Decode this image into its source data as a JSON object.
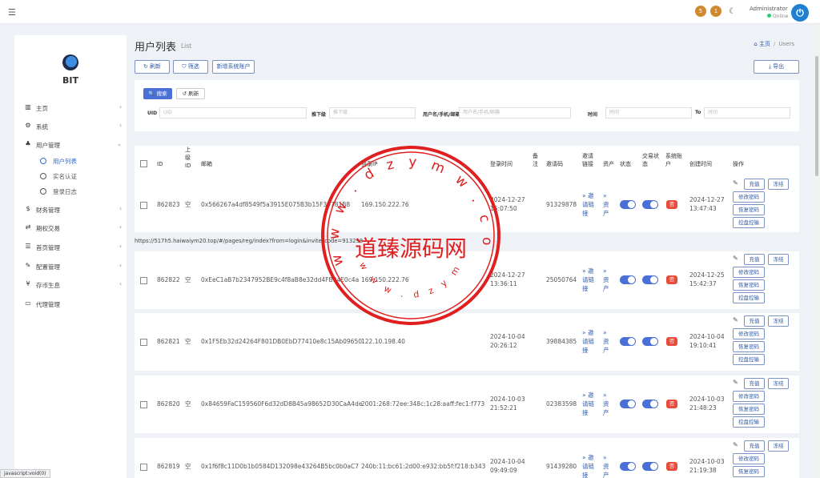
{
  "topbar": {
    "badge1": "5",
    "badge2": "1",
    "admin": "Administrator",
    "online": "Online"
  },
  "sidebar": {
    "brand": "BIT",
    "items": [
      {
        "icon": "bar-chart-icon",
        "glyph": "▥",
        "label": "主页"
      },
      {
        "icon": "gear-icon",
        "glyph": "⚙",
        "label": "系统"
      },
      {
        "icon": "users-icon",
        "glyph": "👤",
        "label": "用户管理"
      },
      {
        "icon": "dollar-icon",
        "glyph": "$",
        "label": "财务管理"
      },
      {
        "icon": "exchange-icon",
        "glyph": "⇄",
        "label": "期权交易"
      },
      {
        "icon": "list-icon",
        "glyph": "☰",
        "label": "首页管理"
      },
      {
        "icon": "wrench-icon",
        "glyph": "🔧",
        "label": "配置管理"
      },
      {
        "icon": "yen-icon",
        "glyph": "¥",
        "label": "存币生息"
      },
      {
        "icon": "id-card-icon",
        "glyph": "▭",
        "label": "代理管理"
      }
    ],
    "sub": [
      "用户列表",
      "实名认证",
      "登录日志"
    ]
  },
  "header": {
    "title": "用户列表",
    "subtitle": "List",
    "crumb_home": "主页",
    "crumb_current": "Users"
  },
  "toolbar": {
    "refresh": "↻ 刷新",
    "filter": "⛉ 筛选",
    "add": "新增系统账户",
    "export": "⤓ 导出"
  },
  "search": {
    "search_btn": "🔍 搜索",
    "reset_btn": "↺ 刷新",
    "uid_label": "UID",
    "uid_placeholder": "UID",
    "parent_label": "推下级",
    "parent_placeholder": "推下级",
    "user_label": "用户名/手机/邮箱",
    "user_placeholder": "用户名/手机/邮箱",
    "time_label": "时间",
    "time_placeholder": "时间",
    "to_label": "To",
    "to_placeholder": "时间"
  },
  "table": {
    "headers": {
      "id": "ID",
      "parent_id": "上级ID",
      "email": "邮箱",
      "ip": "登录IP",
      "login_time": "登录时间",
      "remark": "备注",
      "invite_code": "邀请码",
      "invite_link": "邀请链接",
      "assets": "资产",
      "status": "状态",
      "trade_status": "交易状态",
      "sys_account": "系统账户",
      "created": "创建时间",
      "actions": "操作"
    },
    "rows": [
      {
        "id": "862823",
        "parent": "空",
        "email": "0x566267a4df8549f5a3915E075B3b15F39781B8",
        "ip": "169.150.222.76",
        "login_time": "2024-12-27 15:07:50",
        "code": "91329878",
        "created": "2024-12-27 13:47:43"
      },
      {
        "id": "862822",
        "parent": "空",
        "email": "0xEeC1aB7b2347952BE9c4f8aB8e32dd4FB94E0c4a",
        "ip": "169.150.222.76",
        "login_time": "2024-12-27 13:36:11",
        "code": "25050764",
        "created": "2024-12-25 15:42:37"
      },
      {
        "id": "862821",
        "parent": "空",
        "email": "0x1F5Eb32d24264F801DB0EbD77410e8c15Ab09650",
        "ip": "122.10.198.40",
        "login_time": "2024-10-04 20:26:12",
        "code": "39884385",
        "created": "2024-10-04 19:10:41"
      },
      {
        "id": "862820",
        "parent": "空",
        "email": "0x84659FaC159560F6d32dD8B45a98652D30CaA4de",
        "ip": "2001:268:72ee:348c:1c28:aaff:fec1:f773",
        "login_time": "2024-10-03 21:52:21",
        "code": "02383598",
        "created": "2024-10-03 21:48:23"
      },
      {
        "id": "862819",
        "parent": "空",
        "email": "0x1f6f8c11D0b1b0584D132098e43264B5bc0b0aC7",
        "ip": "240b:11:bc61:2d00:e932:bb5f:f218:b343",
        "login_time": "2024-10-04 09:49:09",
        "code": "91439280",
        "created": "2024-10-03 21:19:38"
      }
    ],
    "invite_link_text": "» 邀请链接",
    "assets_text": "» 资产",
    "sys_no": "否",
    "actions": {
      "recharge": "充值",
      "freeze": "冻结",
      "change_pwd": "修改密码",
      "restore_pwd": "恢复密码",
      "google_ctrl": "控盘控输"
    }
  },
  "url_hint": "https://517h5.haiwaiym20.top/#/pages/reg/index?from=login&invite_code=913298",
  "statusbar": "javascript:void(0)",
  "watermark": {
    "title": "道臻源码网",
    "ring": "w w w . d z y m w . c o m"
  },
  "colors": {
    "accent": "#4a6fd6",
    "danger": "#e74c3c",
    "stamp": "#e02020"
  }
}
